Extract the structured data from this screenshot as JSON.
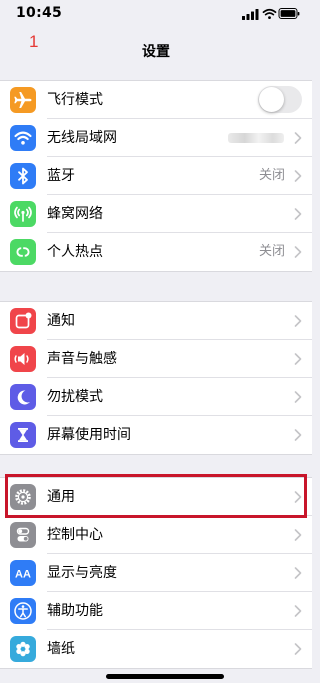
{
  "status_bar": {
    "time": "10:45"
  },
  "annotation": {
    "number": "1"
  },
  "header": {
    "title": "设置"
  },
  "colors": {
    "airplane": "#f59a23",
    "wifi": "#2f7cf6",
    "bluetooth": "#2f7cf6",
    "cellular": "#4cd964",
    "hotspot": "#4cd964",
    "notifications": "#f0454a",
    "sounds": "#f0454a",
    "dnd": "#5e5ce6",
    "screen_time": "#5e5ce6",
    "general": "#8e8e93",
    "control_center": "#8e8e93",
    "display": "#2f7cf6",
    "accessibility": "#2f7cf6",
    "wallpaper": "#36aadc",
    "highlight": "#c8152a",
    "annotation": "#e53935"
  },
  "groups": [
    {
      "items": [
        {
          "label": "飞行模式",
          "icon": "airplane-icon",
          "control": "toggle",
          "toggle_on": false
        },
        {
          "label": "无线局域网",
          "icon": "wifi-icon",
          "value": "",
          "value_blurred": true
        },
        {
          "label": "蓝牙",
          "icon": "bluetooth-icon",
          "value": "关闭"
        },
        {
          "label": "蜂窝网络",
          "icon": "cellular-icon"
        },
        {
          "label": "个人热点",
          "icon": "hotspot-icon",
          "value": "关闭"
        }
      ]
    },
    {
      "items": [
        {
          "label": "通知",
          "icon": "notifications-icon"
        },
        {
          "label": "声音与触感",
          "icon": "sounds-icon"
        },
        {
          "label": "勿扰模式",
          "icon": "moon-icon"
        },
        {
          "label": "屏幕使用时间",
          "icon": "hourglass-icon"
        }
      ]
    },
    {
      "items": [
        {
          "label": "通用",
          "icon": "gear-icon",
          "highlighted": true
        },
        {
          "label": "控制中心",
          "icon": "toggles-icon"
        },
        {
          "label": "显示与亮度",
          "icon": "text-size-icon"
        },
        {
          "label": "辅助功能",
          "icon": "accessibility-icon"
        },
        {
          "label": "墙纸",
          "icon": "flower-icon"
        }
      ]
    }
  ]
}
